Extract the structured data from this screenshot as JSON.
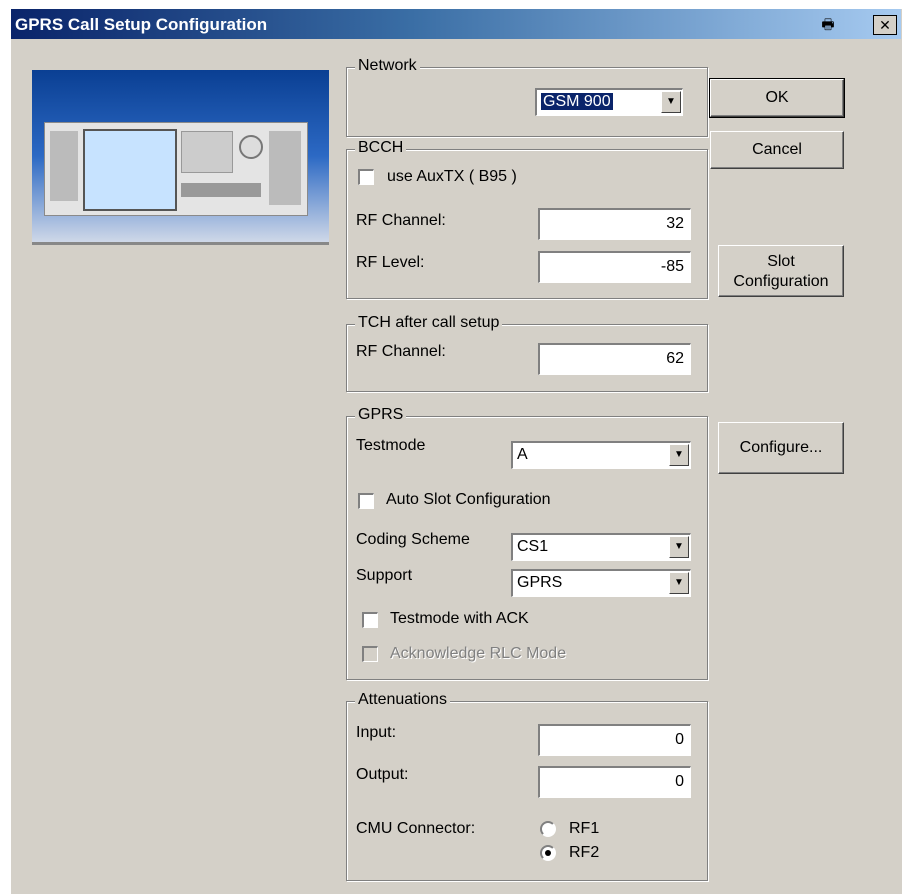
{
  "window": {
    "title": "GPRS Call Setup Configuration"
  },
  "titlebar_icons": {
    "print": "printer-icon",
    "close": "close-icon"
  },
  "titlebar_glyphs": {
    "print": "🖶",
    "close": "✕"
  },
  "network": {
    "legend": "Network",
    "selected": "GSM 900"
  },
  "bcch": {
    "legend": "BCCH",
    "use_auxtx_label": "use AuxTX ( B95 )",
    "rf_channel_label": "RF Channel:",
    "rf_channel_value": "32",
    "rf_level_label": "RF Level:",
    "rf_level_value": "-85"
  },
  "tch": {
    "legend": "TCH after call setup",
    "rf_channel_label": "RF Channel:",
    "rf_channel_value": "62"
  },
  "gprs": {
    "legend": "GPRS",
    "testmode_label": "Testmode",
    "testmode_value": "A",
    "auto_slot_label": "Auto Slot Configuration",
    "coding_scheme_label": "Coding Scheme",
    "coding_scheme_value": "CS1",
    "support_label": "Support",
    "support_value": "GPRS",
    "testmode_ack_label": "Testmode with ACK",
    "ack_rlc_label": "Acknowledge RLC Mode"
  },
  "attenuations": {
    "legend": "Attenuations",
    "input_label": "Input:",
    "input_value": "0",
    "output_label": "Output:",
    "output_value": "0",
    "connector_label": "CMU Connector:",
    "rf1_label": "RF1",
    "rf2_label": "RF2",
    "selected_connector": "RF2"
  },
  "buttons": {
    "ok": "OK",
    "cancel": "Cancel",
    "slot_config_line1": "Slot",
    "slot_config_line2": "Configuration",
    "configure": "Configure..."
  },
  "colors": {
    "titlebar_start": "#0a246a",
    "titlebar_end": "#a6caf0",
    "dialog_bg": "#d4d0c8",
    "selection_bg": "#0a246a"
  }
}
